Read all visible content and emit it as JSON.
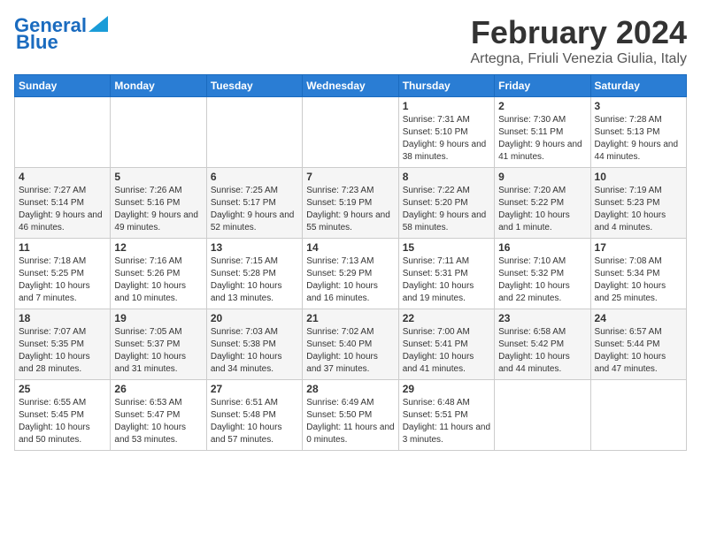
{
  "header": {
    "logo_line1": "General",
    "logo_line2": "Blue",
    "month_year": "February 2024",
    "location": "Artegna, Friuli Venezia Giulia, Italy"
  },
  "weekdays": [
    "Sunday",
    "Monday",
    "Tuesday",
    "Wednesday",
    "Thursday",
    "Friday",
    "Saturday"
  ],
  "weeks": [
    [
      {
        "day": "",
        "content": ""
      },
      {
        "day": "",
        "content": ""
      },
      {
        "day": "",
        "content": ""
      },
      {
        "day": "",
        "content": ""
      },
      {
        "day": "1",
        "content": "Sunrise: 7:31 AM\nSunset: 5:10 PM\nDaylight: 9 hours\nand 38 minutes."
      },
      {
        "day": "2",
        "content": "Sunrise: 7:30 AM\nSunset: 5:11 PM\nDaylight: 9 hours\nand 41 minutes."
      },
      {
        "day": "3",
        "content": "Sunrise: 7:28 AM\nSunset: 5:13 PM\nDaylight: 9 hours\nand 44 minutes."
      }
    ],
    [
      {
        "day": "4",
        "content": "Sunrise: 7:27 AM\nSunset: 5:14 PM\nDaylight: 9 hours\nand 46 minutes."
      },
      {
        "day": "5",
        "content": "Sunrise: 7:26 AM\nSunset: 5:16 PM\nDaylight: 9 hours\nand 49 minutes."
      },
      {
        "day": "6",
        "content": "Sunrise: 7:25 AM\nSunset: 5:17 PM\nDaylight: 9 hours\nand 52 minutes."
      },
      {
        "day": "7",
        "content": "Sunrise: 7:23 AM\nSunset: 5:19 PM\nDaylight: 9 hours\nand 55 minutes."
      },
      {
        "day": "8",
        "content": "Sunrise: 7:22 AM\nSunset: 5:20 PM\nDaylight: 9 hours\nand 58 minutes."
      },
      {
        "day": "9",
        "content": "Sunrise: 7:20 AM\nSunset: 5:22 PM\nDaylight: 10 hours\nand 1 minute."
      },
      {
        "day": "10",
        "content": "Sunrise: 7:19 AM\nSunset: 5:23 PM\nDaylight: 10 hours\nand 4 minutes."
      }
    ],
    [
      {
        "day": "11",
        "content": "Sunrise: 7:18 AM\nSunset: 5:25 PM\nDaylight: 10 hours\nand 7 minutes."
      },
      {
        "day": "12",
        "content": "Sunrise: 7:16 AM\nSunset: 5:26 PM\nDaylight: 10 hours\nand 10 minutes."
      },
      {
        "day": "13",
        "content": "Sunrise: 7:15 AM\nSunset: 5:28 PM\nDaylight: 10 hours\nand 13 minutes."
      },
      {
        "day": "14",
        "content": "Sunrise: 7:13 AM\nSunset: 5:29 PM\nDaylight: 10 hours\nand 16 minutes."
      },
      {
        "day": "15",
        "content": "Sunrise: 7:11 AM\nSunset: 5:31 PM\nDaylight: 10 hours\nand 19 minutes."
      },
      {
        "day": "16",
        "content": "Sunrise: 7:10 AM\nSunset: 5:32 PM\nDaylight: 10 hours\nand 22 minutes."
      },
      {
        "day": "17",
        "content": "Sunrise: 7:08 AM\nSunset: 5:34 PM\nDaylight: 10 hours\nand 25 minutes."
      }
    ],
    [
      {
        "day": "18",
        "content": "Sunrise: 7:07 AM\nSunset: 5:35 PM\nDaylight: 10 hours\nand 28 minutes."
      },
      {
        "day": "19",
        "content": "Sunrise: 7:05 AM\nSunset: 5:37 PM\nDaylight: 10 hours\nand 31 minutes."
      },
      {
        "day": "20",
        "content": "Sunrise: 7:03 AM\nSunset: 5:38 PM\nDaylight: 10 hours\nand 34 minutes."
      },
      {
        "day": "21",
        "content": "Sunrise: 7:02 AM\nSunset: 5:40 PM\nDaylight: 10 hours\nand 37 minutes."
      },
      {
        "day": "22",
        "content": "Sunrise: 7:00 AM\nSunset: 5:41 PM\nDaylight: 10 hours\nand 41 minutes."
      },
      {
        "day": "23",
        "content": "Sunrise: 6:58 AM\nSunset: 5:42 PM\nDaylight: 10 hours\nand 44 minutes."
      },
      {
        "day": "24",
        "content": "Sunrise: 6:57 AM\nSunset: 5:44 PM\nDaylight: 10 hours\nand 47 minutes."
      }
    ],
    [
      {
        "day": "25",
        "content": "Sunrise: 6:55 AM\nSunset: 5:45 PM\nDaylight: 10 hours\nand 50 minutes."
      },
      {
        "day": "26",
        "content": "Sunrise: 6:53 AM\nSunset: 5:47 PM\nDaylight: 10 hours\nand 53 minutes."
      },
      {
        "day": "27",
        "content": "Sunrise: 6:51 AM\nSunset: 5:48 PM\nDaylight: 10 hours\nand 57 minutes."
      },
      {
        "day": "28",
        "content": "Sunrise: 6:49 AM\nSunset: 5:50 PM\nDaylight: 11 hours\nand 0 minutes."
      },
      {
        "day": "29",
        "content": "Sunrise: 6:48 AM\nSunset: 5:51 PM\nDaylight: 11 hours\nand 3 minutes."
      },
      {
        "day": "",
        "content": ""
      },
      {
        "day": "",
        "content": ""
      }
    ]
  ]
}
